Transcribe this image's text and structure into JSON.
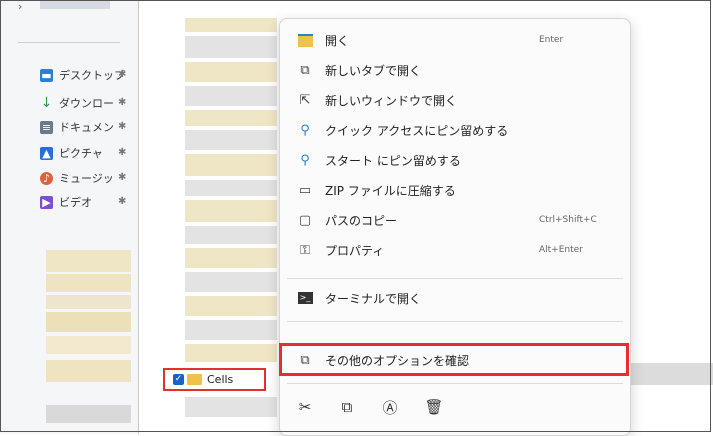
{
  "sidebar": {
    "items": [
      {
        "label": "デスクトップ",
        "icon": "desktop-icon",
        "color": "#2b7fd6"
      },
      {
        "label": "ダウンロー",
        "icon": "download-icon",
        "color": "#2a9d52"
      },
      {
        "label": "ドキュメン",
        "icon": "document-icon",
        "color": "#6c7a8c"
      },
      {
        "label": "ピクチャ",
        "icon": "pictures-icon",
        "color": "#2b6ed6"
      },
      {
        "label": "ミュージッ",
        "icon": "music-icon",
        "color": "#e2603a"
      },
      {
        "label": "ビデオ",
        "icon": "video-icon",
        "color": "#7b4fd0"
      }
    ]
  },
  "file": {
    "name": "Cells",
    "checked": true
  },
  "context_menu": {
    "items": [
      {
        "label": "開く",
        "shortcut": "Enter",
        "icon": "folder-open-icon"
      },
      {
        "label": "新しいタブで開く",
        "shortcut": "",
        "icon": "new-tab-icon"
      },
      {
        "label": "新しいウィンドウで開く",
        "shortcut": "",
        "icon": "new-window-icon"
      },
      {
        "label": "クイック アクセスにピン留めする",
        "shortcut": "",
        "icon": "pin-icon"
      },
      {
        "label": "スタート にピン留めする",
        "shortcut": "",
        "icon": "pin-icon"
      },
      {
        "label": "ZIP ファイルに圧縮する",
        "shortcut": "",
        "icon": "zip-icon"
      },
      {
        "label": "パスのコピー",
        "shortcut": "Ctrl+Shift+C",
        "icon": "copy-path-icon"
      },
      {
        "label": "プロパティ",
        "shortcut": "Alt+Enter",
        "icon": "properties-icon"
      },
      {
        "label": "ターミナルで開く",
        "shortcut": "",
        "icon": "terminal-icon"
      },
      {
        "label": "その他のオプションを確認",
        "shortcut": "",
        "icon": "more-options-icon"
      }
    ],
    "bottom_actions": [
      "cut-icon",
      "copy-icon",
      "rename-icon",
      "delete-icon"
    ]
  },
  "colors": {
    "highlight": "#e52e2e",
    "accent": "#1a63c6",
    "folder": "#f1c24a"
  }
}
